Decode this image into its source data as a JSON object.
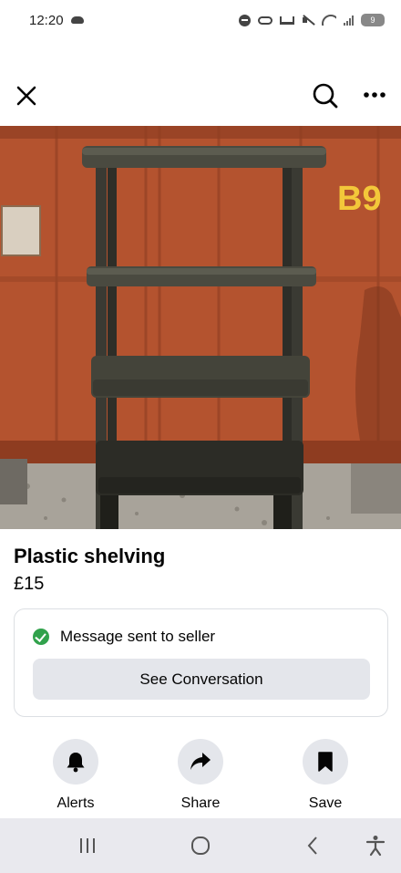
{
  "status_bar": {
    "time": "12:20",
    "battery": "9",
    "icons": [
      "cloud-icon",
      "dnd-icon",
      "key-icon",
      "bed-icon",
      "mute-icon",
      "wifi-icon",
      "signal-icon",
      "battery-icon"
    ]
  },
  "top_bar": {
    "icons": [
      "close-icon",
      "search-icon",
      "more-icon"
    ]
  },
  "photo": {
    "container_label": "B9",
    "container_color": "#b5532f",
    "shelf_color": "#3a3a33"
  },
  "listing": {
    "title": "Plastic shelving",
    "price": "£15"
  },
  "message_card": {
    "status_text": "Message sent to seller",
    "button_label": "See Conversation",
    "status_color": "#31a24c"
  },
  "actions": [
    {
      "label": "Alerts",
      "icon": "bell-icon"
    },
    {
      "label": "Share",
      "icon": "share-arrow-icon"
    },
    {
      "label": "Save",
      "icon": "bookmark-icon"
    }
  ],
  "nav_bar": {
    "icons": [
      "recent-apps-icon",
      "home-icon",
      "back-icon",
      "accessibility-icon"
    ]
  }
}
